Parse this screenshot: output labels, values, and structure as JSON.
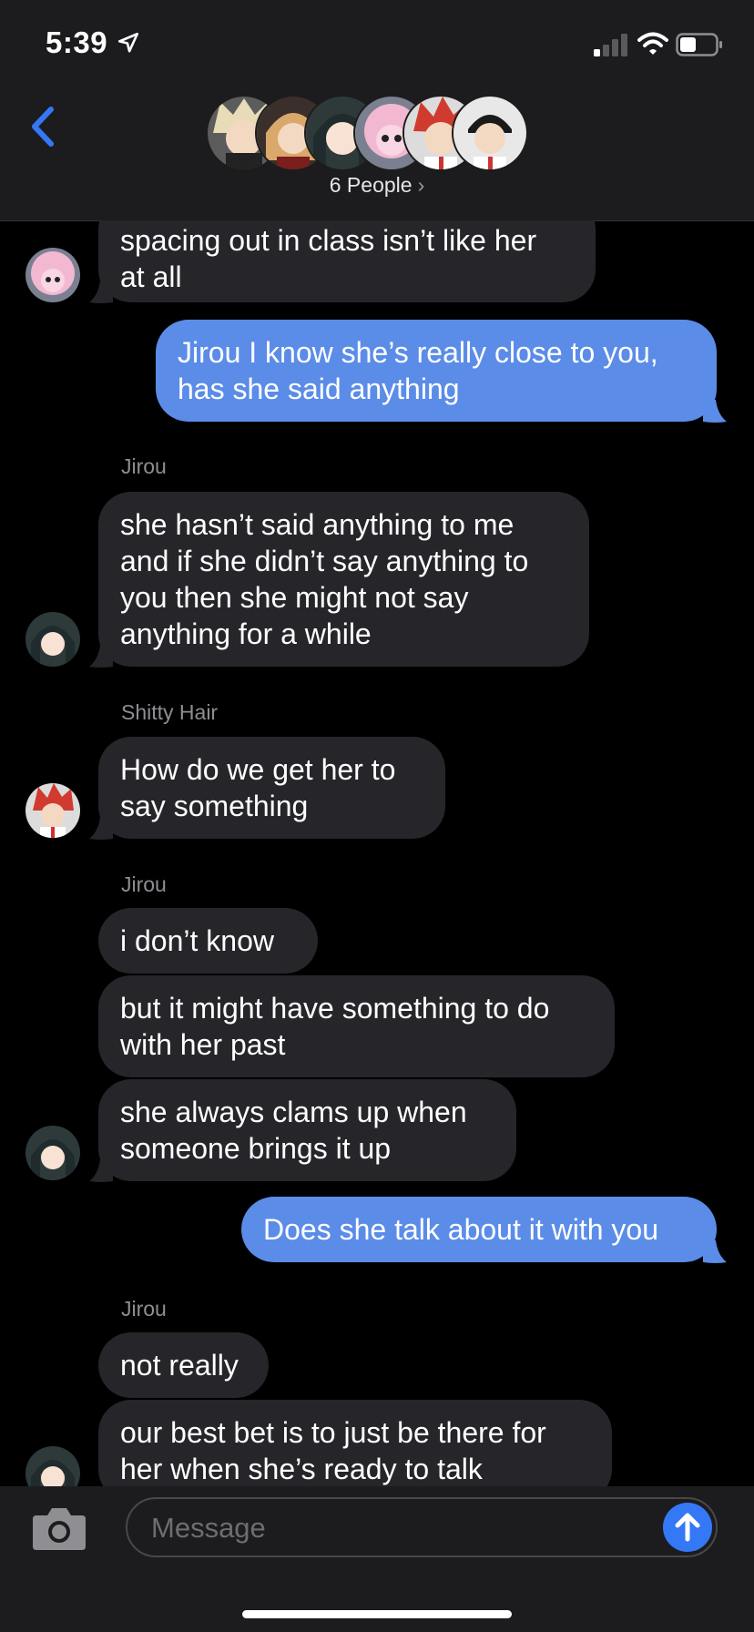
{
  "status": {
    "time": "5:39"
  },
  "header": {
    "people_label": "6 People",
    "chevron": "›"
  },
  "colors": {
    "outgoing": "#5b8ce8",
    "incoming": "#26262a",
    "send": "#3478f6"
  },
  "messages": [
    {
      "text": "spacing out in class isn’t like her\nat all"
    },
    {
      "text": "Jirou I know she’s really close to you,\nhas she said anything"
    },
    {
      "sender": "Jirou"
    },
    {
      "text": "she hasn’t said anything to me\nand if she didn’t say anything to\nyou then she might not say\nanything for a while"
    },
    {
      "sender": "Shitty Hair"
    },
    {
      "text": "How do we get her to\nsay something"
    },
    {
      "sender": "Jirou"
    },
    {
      "text": "i don’t know"
    },
    {
      "text": "but it might have something to do\nwith her past"
    },
    {
      "text": "she always clams up when\nsomeone brings it up"
    },
    {
      "text": "Does she talk about it with you"
    },
    {
      "sender": "Jirou"
    },
    {
      "text": "not really"
    },
    {
      "text": "our best bet is to just be there for\nher when she’s ready to talk"
    }
  ],
  "input": {
    "placeholder": "Message"
  }
}
